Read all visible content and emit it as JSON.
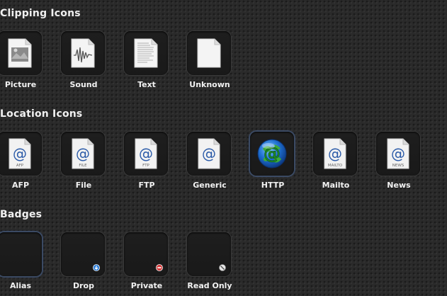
{
  "sections": [
    {
      "title": "Clipping Icons",
      "items": [
        {
          "label": "Picture",
          "icon": "picture-clipping-icon"
        },
        {
          "label": "Sound",
          "icon": "sound-clipping-icon"
        },
        {
          "label": "Text",
          "icon": "text-clipping-icon"
        },
        {
          "label": "Unknown",
          "icon": "unknown-clipping-icon"
        }
      ]
    },
    {
      "title": "Location Icons",
      "items": [
        {
          "label": "AFP",
          "icon": "afp-location-icon",
          "tag": "AFP"
        },
        {
          "label": "File",
          "icon": "file-location-icon",
          "tag": "FILE"
        },
        {
          "label": "FTP",
          "icon": "ftp-location-icon",
          "tag": "FTP"
        },
        {
          "label": "Generic",
          "icon": "generic-location-icon",
          "tag": ""
        },
        {
          "label": "HTTP",
          "icon": "http-globe-icon",
          "selected": true
        },
        {
          "label": "Mailto",
          "icon": "mailto-location-icon",
          "tag": "MAILTO"
        },
        {
          "label": "News",
          "icon": "news-location-icon",
          "tag": "NEWS"
        }
      ]
    },
    {
      "title": "Badges",
      "items": [
        {
          "label": "Alias",
          "icon": "alias-badge",
          "selected": true
        },
        {
          "label": "Drop",
          "icon": "drop-badge-icon"
        },
        {
          "label": "Private",
          "icon": "private-badge-icon"
        },
        {
          "label": "Read Only",
          "icon": "read-only-badge-icon"
        }
      ]
    }
  ],
  "colors": {
    "badge_drop": "#2a7bd6",
    "badge_private": "#d43b3b",
    "badge_readonly": "#e6e6e6",
    "at_sign": "#2a5aa8"
  }
}
